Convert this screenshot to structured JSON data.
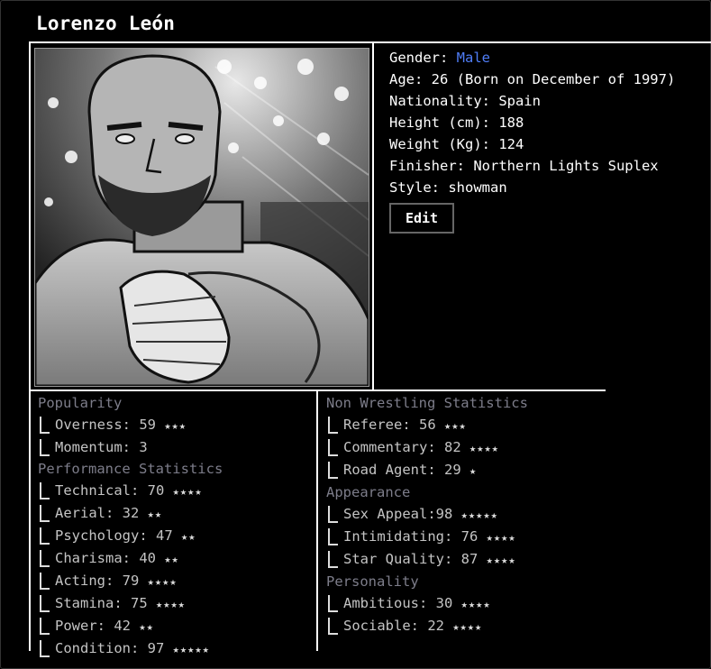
{
  "profile": {
    "name": "Lorenzo León",
    "gender_label": "Gender:",
    "gender_value": "Male",
    "age": "Age: 26 (Born on December of 1997)",
    "nationality": "Nationality: Spain",
    "height": "Height (cm): 188",
    "weight": "Weight (Kg): 124",
    "finisher": "Finisher: Northern Lights Suplex",
    "style": "Style: showman",
    "edit_label": "Edit",
    "accent_color": "#4f7df7"
  },
  "left_stats": [
    {
      "heading": "Popularity",
      "items": [
        {
          "label": "Overness: 59",
          "stars": "★★★"
        },
        {
          "label": "Momentum: 3",
          "stars": ""
        }
      ]
    },
    {
      "heading": "Performance Statistics",
      "items": [
        {
          "label": "Technical: 70",
          "stars": "★★★★"
        },
        {
          "label": "Aerial: 32",
          "stars": "★★"
        },
        {
          "label": "Psychology: 47",
          "stars": "★★"
        },
        {
          "label": "Charisma: 40",
          "stars": "★★"
        },
        {
          "label": "Acting: 79",
          "stars": "★★★★"
        },
        {
          "label": "Stamina: 75",
          "stars": "★★★★"
        },
        {
          "label": "Power: 42",
          "stars": "★★"
        },
        {
          "label": "Condition: 97",
          "stars": "★★★★★"
        }
      ]
    }
  ],
  "right_stats": [
    {
      "heading": "Non Wrestling Statistics",
      "items": [
        {
          "label": "Referee: 56",
          "stars": "★★★"
        },
        {
          "label": "Commentary: 82",
          "stars": "★★★★"
        },
        {
          "label": "Road Agent: 29",
          "stars": "★"
        }
      ]
    },
    {
      "heading": "Appearance",
      "items": [
        {
          "label": "Sex Appeal:98",
          "stars": "★★★★★"
        },
        {
          "label": "Intimidating: 76",
          "stars": "★★★★"
        },
        {
          "label": "Star Quality: 87",
          "stars": "★★★★"
        }
      ]
    },
    {
      "heading": "Personality",
      "items": [
        {
          "label": "Ambitious: 30",
          "stars": "★★★★"
        },
        {
          "label": "Sociable: 22",
          "stars": "★★★★"
        }
      ]
    }
  ]
}
